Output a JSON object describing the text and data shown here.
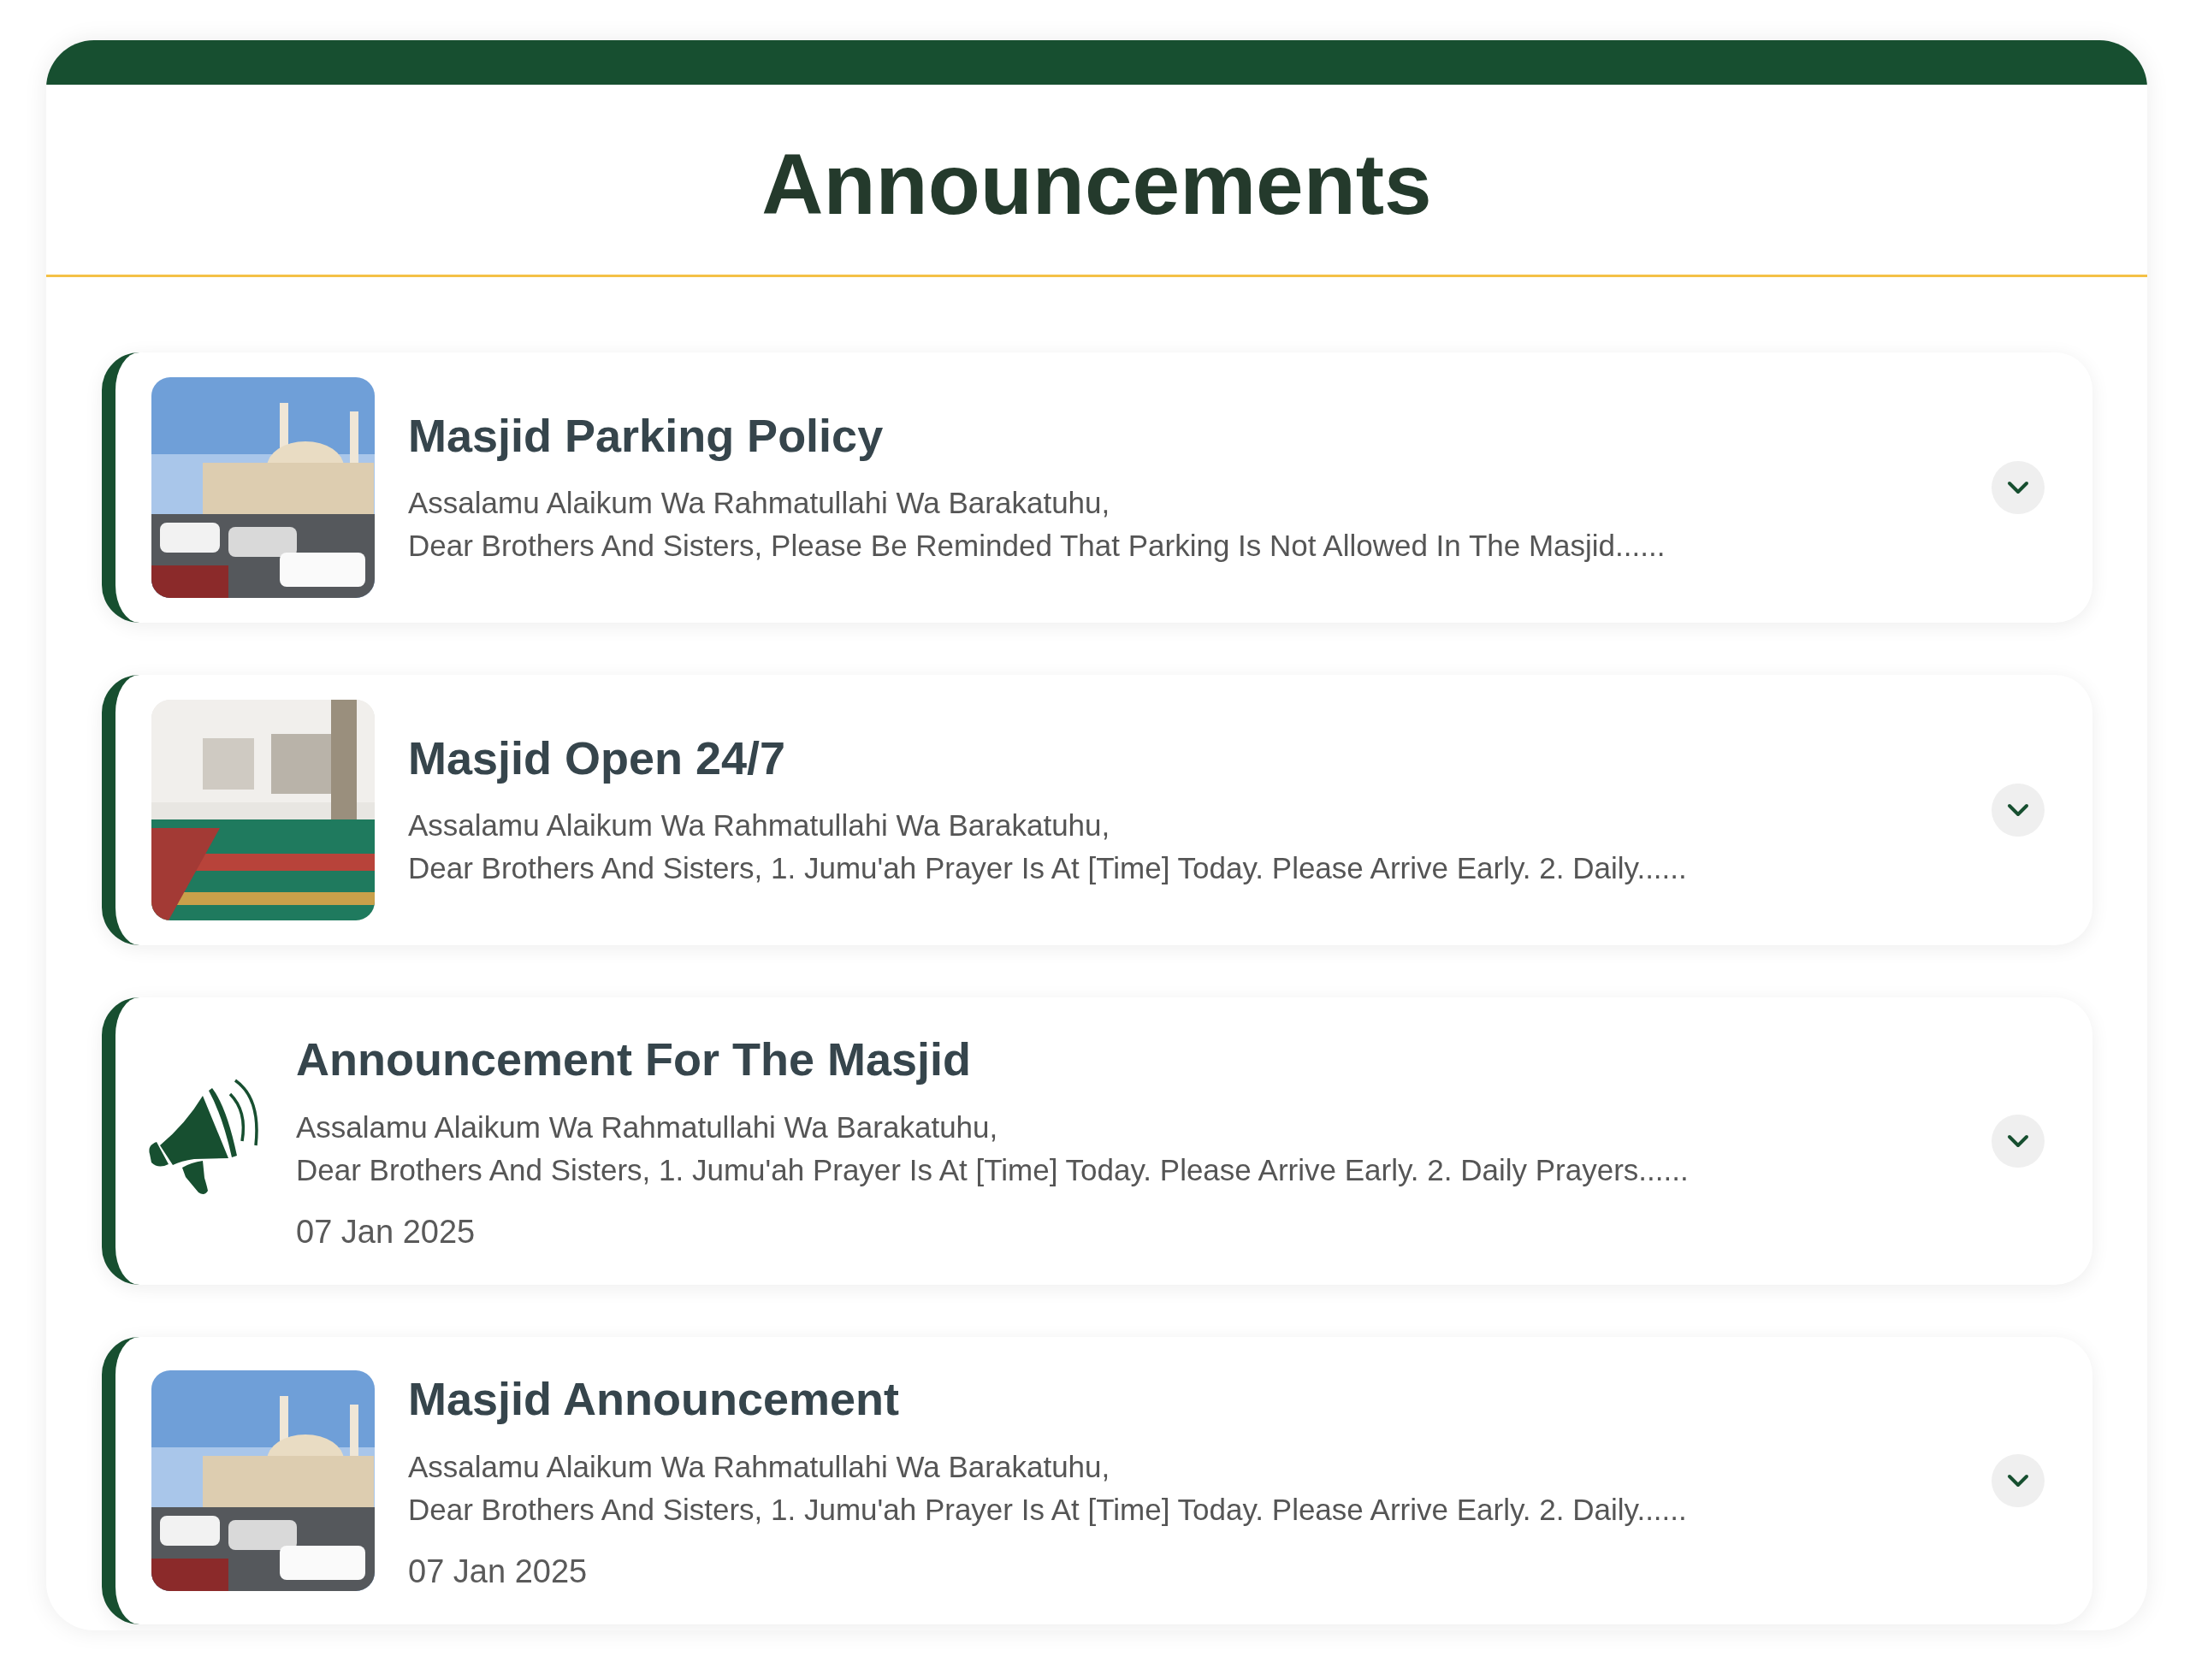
{
  "header": {
    "title": "Announcements"
  },
  "announcements": [
    {
      "kind": "picture",
      "title": "Masjid Parking Policy",
      "lines": [
        "Assalamu Alaikum Wa Rahmatullahi Wa Barakatuhu,",
        "Dear Brothers And Sisters, Please Be Reminded That Parking Is Not Allowed In The Masjid......"
      ],
      "expanded": false
    },
    {
      "kind": "picture",
      "title": "Masjid Open 24/7",
      "lines": [
        "Assalamu Alaikum Wa Rahmatullahi Wa Barakatuhu,",
        "Dear Brothers And Sisters, 1. Jumu'ah Prayer Is At [Time] Today. Please Arrive Early. 2. Daily......"
      ],
      "expanded": false
    },
    {
      "kind": "icon",
      "title": "Announcement For The Masjid",
      "lines": [
        "Assalamu Alaikum Wa Rahmatullahi Wa Barakatuhu,",
        "Dear Brothers And Sisters, 1. Jumu'ah Prayer Is At [Time] Today. Please Arrive Early. 2. Daily Prayers......"
      ],
      "date": "07 Jan 2025",
      "expanded": false
    },
    {
      "kind": "picture",
      "title": "Masjid Announcement",
      "lines": [
        "Assalamu Alaikum Wa Rahmatullahi Wa Barakatuhu,",
        "Dear Brothers And Sisters, 1. Jumu'ah Prayer Is At [Time] Today. Please Arrive Early. 2. Daily......"
      ],
      "date": "07 Jan 2025",
      "expanded": false
    }
  ]
}
